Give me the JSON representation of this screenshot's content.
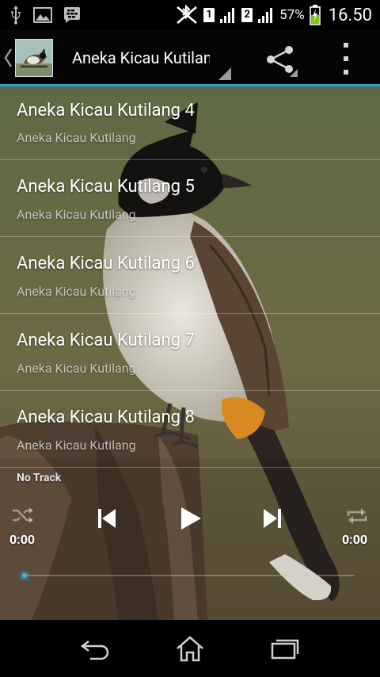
{
  "status_bar": {
    "left_icons": [
      "usb-icon",
      "image-icon",
      "bbm-icon"
    ],
    "sim1_label": "1",
    "sim2_label": "2",
    "battery_percent": "57%",
    "time": "16.50"
  },
  "action_bar": {
    "title": "Aneka Kicau Kutilang",
    "share_icon": "share-icon",
    "overflow_icon": "overflow-menu-icon"
  },
  "tracks": [
    {
      "title": "Aneka Kicau Kutilang 4",
      "subtitle": "Aneka Kicau Kutilang"
    },
    {
      "title": "Aneka Kicau Kutilang 5",
      "subtitle": "Aneka Kicau Kutilang"
    },
    {
      "title": "Aneka Kicau Kutilang 6",
      "subtitle": "Aneka Kicau Kutilang"
    },
    {
      "title": "Aneka Kicau Kutilang 7",
      "subtitle": "Aneka Kicau Kutilang"
    },
    {
      "title": "Aneka Kicau Kutilang 8",
      "subtitle": "Aneka Kicau Kutilang"
    }
  ],
  "player": {
    "now_playing": "No Track",
    "elapsed": "0:00",
    "duration": "0:00",
    "progress": 0,
    "accent": "#33b5e5"
  },
  "nav_bar": {
    "icons": [
      "back-icon",
      "home-icon",
      "recent-apps-icon"
    ]
  }
}
